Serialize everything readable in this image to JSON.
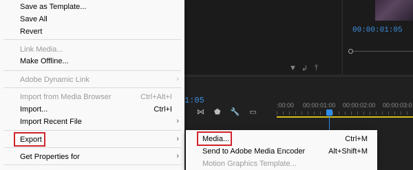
{
  "program": {
    "timecode": "00:00:01:05"
  },
  "timeline": {
    "timecode_fragment": "1:05",
    "ruler_labels": [
      ":00:00",
      "00:00:01:00",
      "00:00:02:00",
      "00:00:03:0"
    ]
  },
  "file_menu": {
    "items": [
      {
        "label": "Save as Template...",
        "shortcut": "",
        "disabled": false,
        "submenu": false
      },
      {
        "label": "Save All",
        "shortcut": "",
        "disabled": false,
        "submenu": false
      },
      {
        "label": "Revert",
        "shortcut": "",
        "disabled": false,
        "submenu": false
      },
      {
        "label": "Link Media...",
        "shortcut": "",
        "disabled": true,
        "submenu": false
      },
      {
        "label": "Make Offline...",
        "shortcut": "",
        "disabled": false,
        "submenu": false
      },
      {
        "label": "Adobe Dynamic Link",
        "shortcut": "",
        "disabled": true,
        "submenu": true
      },
      {
        "label": "Import from Media Browser",
        "shortcut": "Ctrl+Alt+I",
        "disabled": true,
        "submenu": false
      },
      {
        "label": "Import...",
        "shortcut": "Ctrl+I",
        "disabled": false,
        "submenu": false
      },
      {
        "label": "Import Recent File",
        "shortcut": "",
        "disabled": false,
        "submenu": true
      },
      {
        "label": "Export",
        "shortcut": "",
        "disabled": false,
        "submenu": true,
        "highlighted": true
      },
      {
        "label": "Get Properties for",
        "shortcut": "",
        "disabled": false,
        "submenu": true
      }
    ]
  },
  "export_submenu": {
    "items": [
      {
        "label": "Media...",
        "shortcut": "Ctrl+M",
        "disabled": false,
        "highlighted": true
      },
      {
        "label": "Send to Adobe Media Encoder",
        "shortcut": "Alt+Shift+M",
        "disabled": false
      },
      {
        "label": "Motion Graphics Template...",
        "shortcut": "",
        "disabled": true
      }
    ]
  },
  "colors": {
    "highlight_box": "#d0242a",
    "timecode": "#3d8fe0",
    "playhead": "#2d8ceb",
    "work_area": "#d6c21a"
  }
}
